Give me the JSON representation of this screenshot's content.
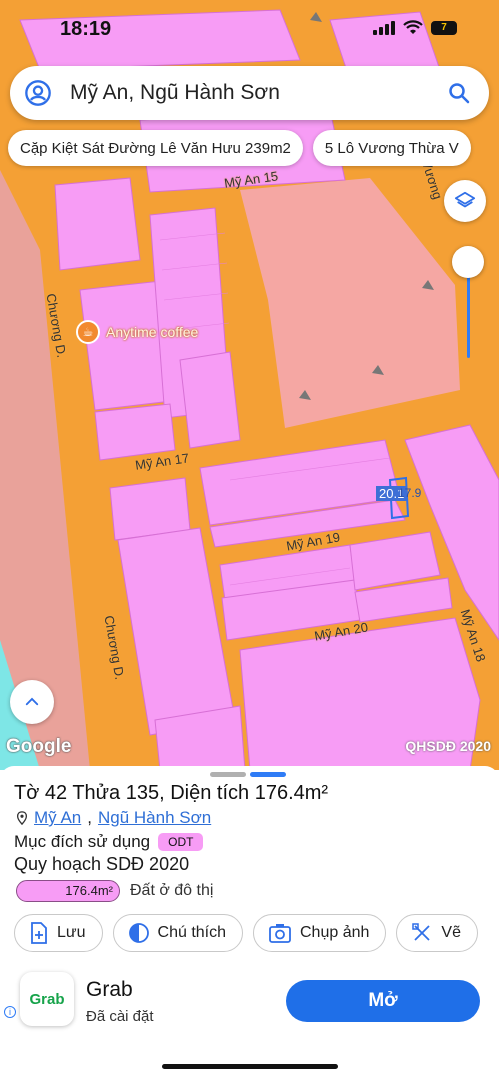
{
  "status_bar": {
    "time": "18:19",
    "battery": "7"
  },
  "search": {
    "text": "Mỹ An, Ngũ Hành Sơn"
  },
  "chips": [
    "Cặp Kiệt Sát Đường Lê Văn Hưu 239m2",
    "5 Lô Vương Thừa V"
  ],
  "map": {
    "road_labels": [
      "Mỹ An 15",
      "Chương D.",
      "Mỹ An 17",
      "Mỹ An 19",
      "Chương D.",
      "Mỹ An 20",
      "Mỹ An 18",
      "Vương"
    ],
    "poi": "Anytime coffee",
    "plot_label": "20.1",
    "plot_label2": "17.9",
    "google": "Google",
    "attribution": "QHSDĐ 2020"
  },
  "sheet": {
    "title": "Tờ 42 Thửa 135, Diện tích 176.4m²",
    "loc_ward": "Mỹ An",
    "loc_sep": ",",
    "loc_district": "Ngũ Hành Sơn",
    "purpose_label": "Mục đích sử dụng",
    "purpose_code": "ODT",
    "plan_title": "Quy hoạch SDĐ 2020",
    "legend_value": "176.4m²",
    "legend_label": "Đất ở đô thị",
    "actions": [
      "Lưu",
      "Chú thích",
      "Chụp ảnh",
      "Vẽ"
    ]
  },
  "ad": {
    "name": "Grab",
    "logo_text": "Grab",
    "subtitle": "Đã cài đặt",
    "button": "Mở"
  },
  "colors": {
    "road": "#f4a035",
    "residential": "#f79cf5",
    "public": "#f5a7a3",
    "accent": "#1f6fe8"
  }
}
